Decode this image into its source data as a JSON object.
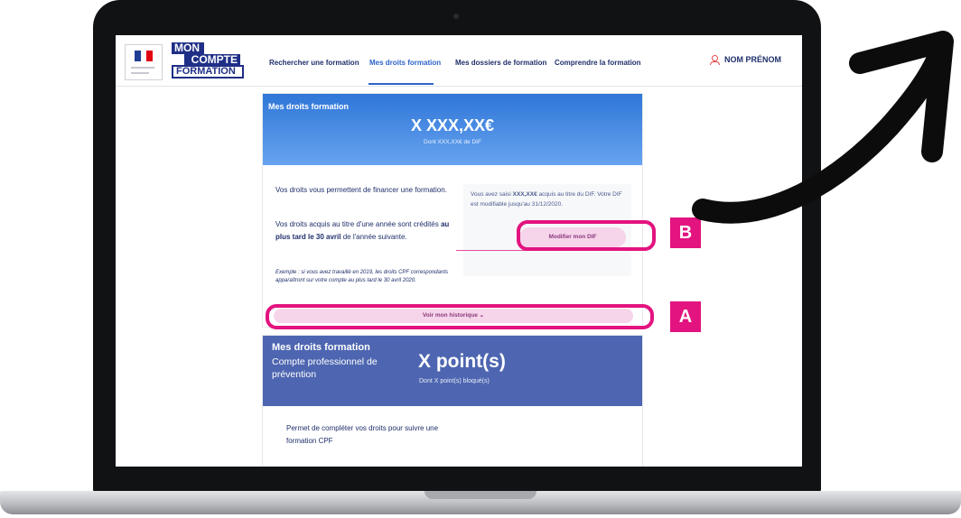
{
  "header": {
    "logo": {
      "line1": "MON",
      "line2": "COMPTE",
      "line3": "FORMATION"
    },
    "nav": [
      {
        "label": "Rechercher une formation"
      },
      {
        "label": "Mes droits formation",
        "active": true
      },
      {
        "label": "Mes dossiers de formation"
      },
      {
        "label": "Comprendre la formation"
      }
    ],
    "user_label": "NOM PRÉNOM",
    "user_icon": "user-icon"
  },
  "rights_card": {
    "title": "Mes droits formation",
    "amount": "X XXX,XX€",
    "dif_note": "Dont XXX,XX€ de DIF",
    "intro": "Vos droits vous permettent de financer une formation.",
    "credit_before": "Vos droits acquis au titre d'une année sont crédités ",
    "credit_bold": "au plus tard le 30 avril",
    "credit_after": " de l'année suivante.",
    "example": "Exemple : si vous avez travaillé en 2019, les droits CPF correspondants apparaîtront sur votre compte au plus tard le 30 avril 2020.",
    "dif_box_before": "Vous avez saisi ",
    "dif_box_amount": "XXX,XX€",
    "dif_box_after": " acquis au titre du DIF. Votre DIF est modifiable jusqu'au 31/12/2020.",
    "modify_button": "Modifier mon DIF",
    "history_button": "Voir mon historique"
  },
  "prevention_card": {
    "title": "Mes droits formation",
    "subtitle": "Compte professionnel de prévention",
    "points": "X point(s)",
    "blocked": "Dont X point(s) bloqué(s)",
    "body": "Permet de compléter vos droits pour suivre une formation CPF"
  },
  "annotations": [
    {
      "label": "A"
    },
    {
      "label": "B"
    }
  ],
  "colors": {
    "highlight": "#e3137f",
    "hero_blue": "#2f76d8",
    "prevention_blue": "#4e66b1",
    "button_pink": "#f6d4ea",
    "text_navy": "#1f2f6b"
  }
}
